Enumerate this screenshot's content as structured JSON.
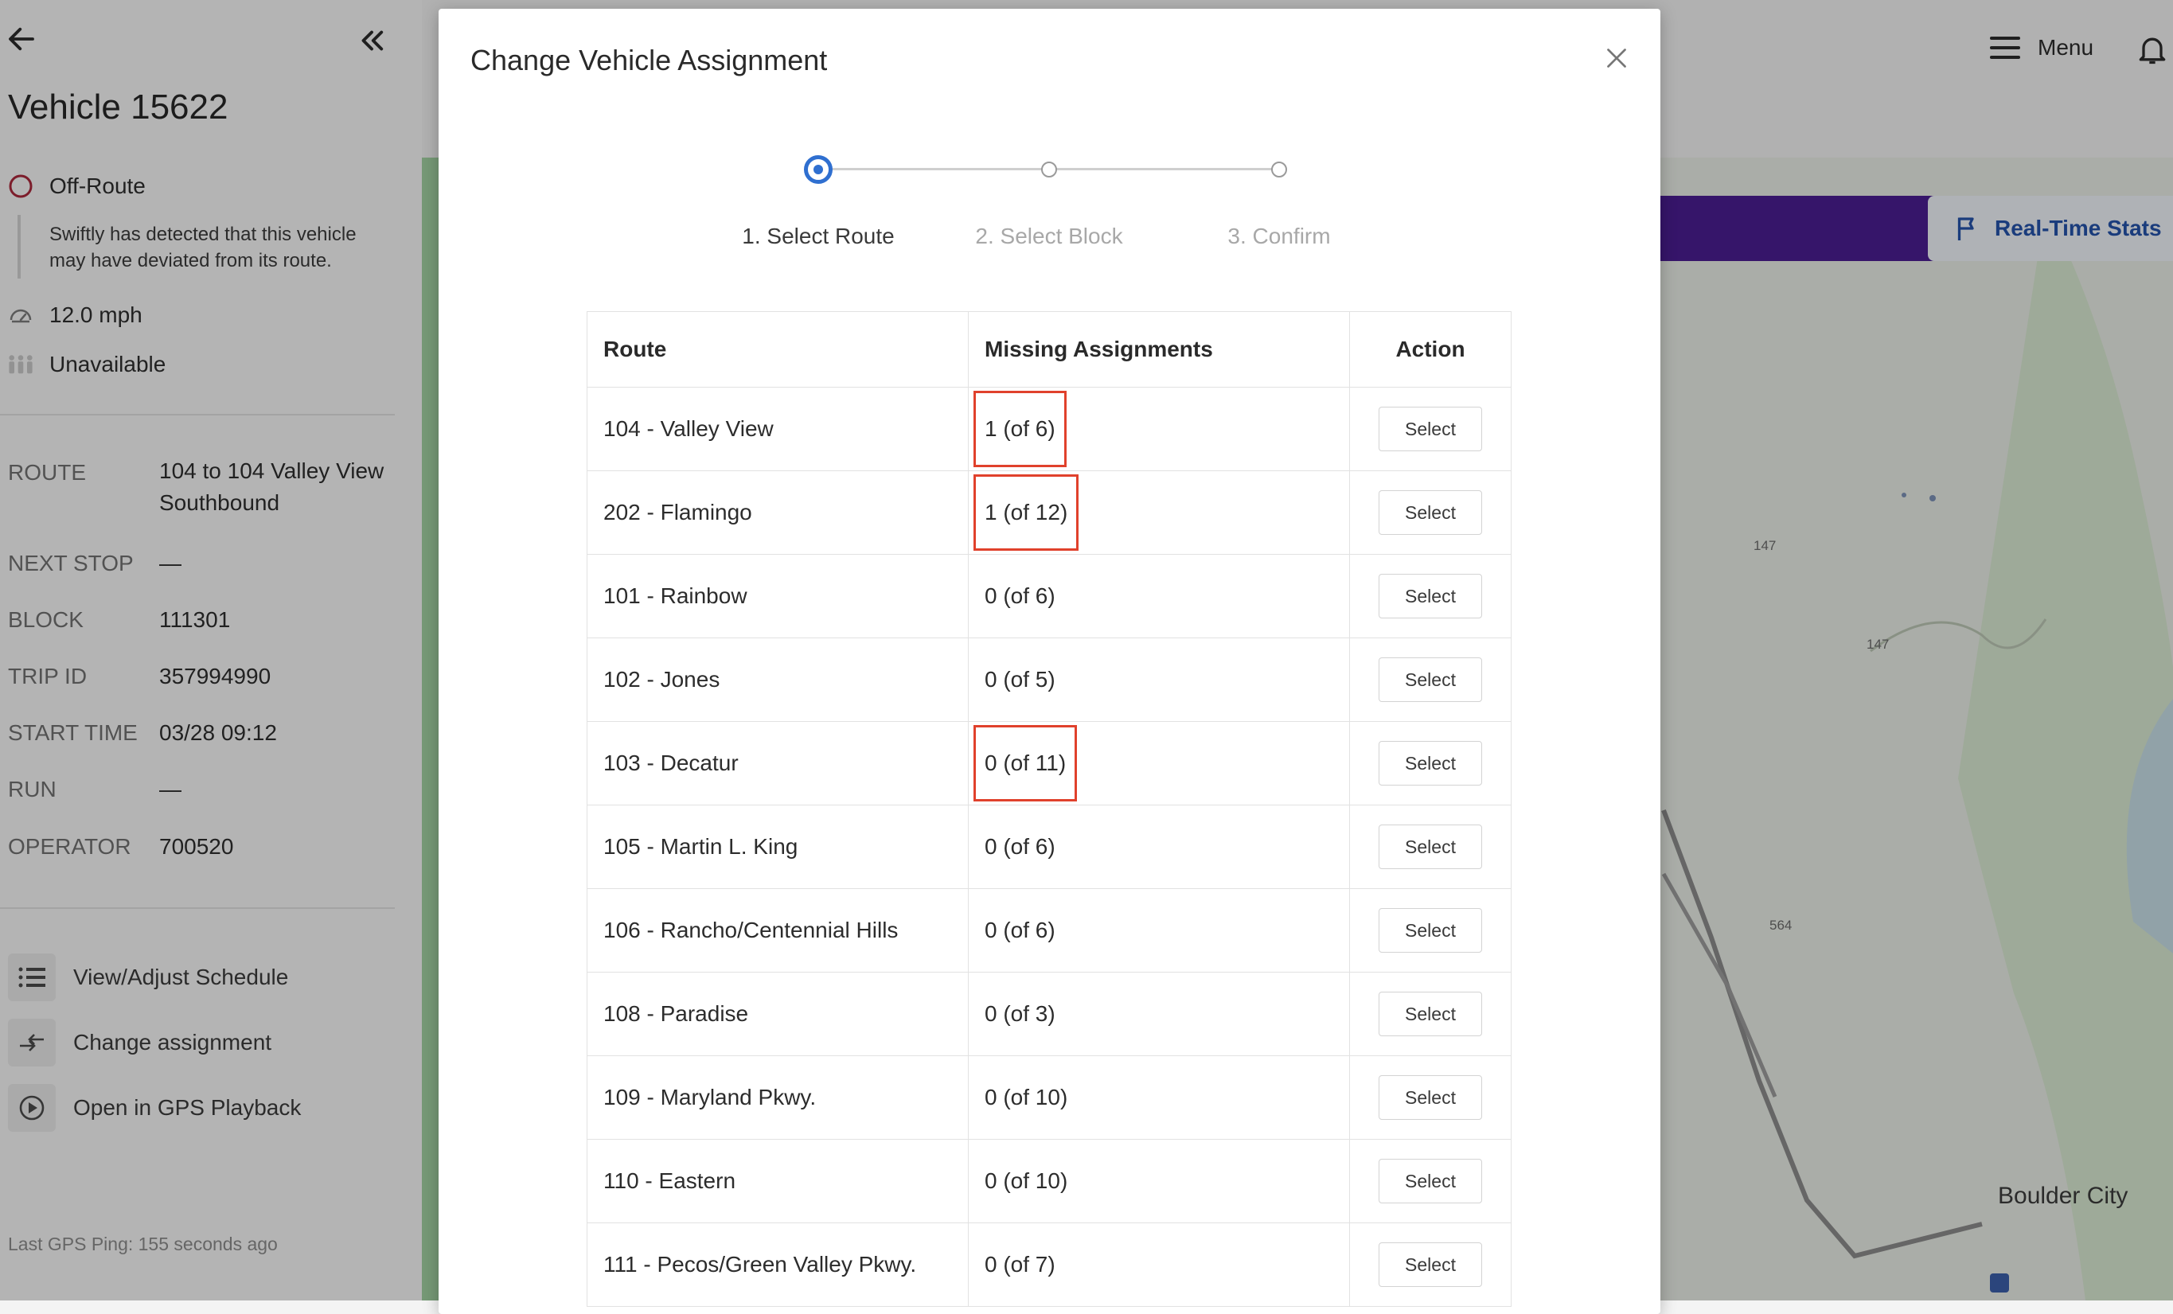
{
  "sidebar": {
    "vehicle_title": "Vehicle 15622",
    "status": {
      "label": "Off-Route",
      "note": "Swiftly has detected that this vehicle may have deviated from its route.",
      "color": "#a8283a"
    },
    "speed": "12.0 mph",
    "capacity": "Unavailable",
    "details": [
      {
        "key": "ROUTE",
        "value": "104 to 104 Valley View Southbound"
      },
      {
        "key": "NEXT STOP",
        "value": "—"
      },
      {
        "key": "BLOCK",
        "value": "111301"
      },
      {
        "key": "TRIP ID",
        "value": "357994990"
      },
      {
        "key": "START TIME",
        "value": "03/28 09:12"
      },
      {
        "key": "RUN",
        "value": "—"
      },
      {
        "key": "OPERATOR",
        "value": "700520"
      }
    ],
    "actions": [
      {
        "label": "View/Adjust Schedule",
        "icon": "list-icon"
      },
      {
        "label": "Change assignment",
        "icon": "swap-icon"
      },
      {
        "label": "Open in GPS Playback",
        "icon": "play-icon"
      }
    ],
    "last_ping": "Last GPS Ping: 155 seconds ago"
  },
  "header": {
    "menu_label": "Menu",
    "real_time_stats": "Real-Time Stats",
    "banner_color": "#4a1d8f"
  },
  "map": {
    "labels": {
      "hwy_a": "147",
      "hwy_b": "147",
      "hwy_c": "564",
      "city": "Boulder City"
    }
  },
  "modal": {
    "title": "Change Vehicle Assignment",
    "steps": [
      {
        "label": "1. Select Route",
        "active": true
      },
      {
        "label": "2. Select Block",
        "active": false
      },
      {
        "label": "3. Confirm",
        "active": false
      }
    ],
    "accent_color": "#2f6fd0",
    "highlight_color": "#e0412c",
    "table": {
      "headers": {
        "route": "Route",
        "missing": "Missing Assignments",
        "action": "Action"
      },
      "button_label": "Select",
      "rows": [
        {
          "route": "104 - Valley View",
          "missing": "1 (of 6)",
          "highlighted": true
        },
        {
          "route": "202 - Flamingo",
          "missing": "1 (of 12)",
          "highlighted": true
        },
        {
          "route": "101 - Rainbow",
          "missing": "0 (of 6)",
          "highlighted": false
        },
        {
          "route": "102 - Jones",
          "missing": "0 (of 5)",
          "highlighted": false
        },
        {
          "route": "103 - Decatur",
          "missing": "0 (of 11)",
          "highlighted": true
        },
        {
          "route": "105 - Martin L. King",
          "missing": "0 (of 6)",
          "highlighted": false
        },
        {
          "route": "106 - Rancho/Centennial Hills",
          "missing": "0 (of 6)",
          "highlighted": false
        },
        {
          "route": "108 - Paradise",
          "missing": "0 (of 3)",
          "highlighted": false
        },
        {
          "route": "109 - Maryland Pkwy.",
          "missing": "0 (of 10)",
          "highlighted": false
        },
        {
          "route": "110 - Eastern",
          "missing": "0 (of 10)",
          "highlighted": false
        },
        {
          "route": "111 - Pecos/Green Valley Pkwy.",
          "missing": "0 (of 7)",
          "highlighted": false
        }
      ]
    }
  }
}
